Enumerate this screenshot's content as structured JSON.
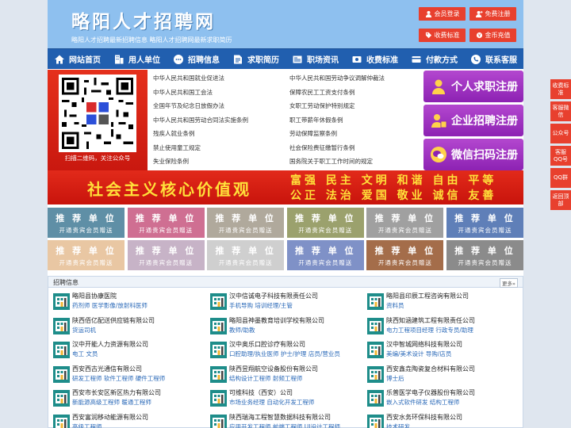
{
  "header": {
    "title": "略阳人才招聘网",
    "subtitle": "略阳人才招聘最新招聘信息  略阳人才招聘网最新求职简历",
    "buttons": [
      {
        "label": "会员登录",
        "icon": "user-icon"
      },
      {
        "label": "免费注册",
        "icon": "user-plus-icon"
      },
      {
        "label": "收费标准",
        "icon": "tag-icon"
      },
      {
        "label": "金币充值",
        "icon": "coin-icon"
      }
    ]
  },
  "nav": [
    {
      "label": "网站首页",
      "icon": "home-icon"
    },
    {
      "label": "用人单位",
      "icon": "building-icon"
    },
    {
      "label": "招聘信息",
      "icon": "chat-icon"
    },
    {
      "label": "求职简历",
      "icon": "resume-icon"
    },
    {
      "label": "职场资讯",
      "icon": "news-icon"
    },
    {
      "label": "收费标准",
      "icon": "money-icon"
    },
    {
      "label": "付款方式",
      "icon": "card-icon"
    },
    {
      "label": "联系客服",
      "icon": "phone-icon"
    }
  ],
  "qr_caption": "扫描二维码，关注公众号",
  "laws": [
    "中华人民共和国就业促进法",
    "中华人民共和国劳动争议调解仲裁法",
    "中华人民共和国工会法",
    "保障农民工工资支付条例",
    "全国年节及纪念日放假办法",
    "女职工劳动保护特别规定",
    "中华人民共和国劳动合同法实施条例",
    "职工带薪年休假条例",
    "残疾人就业条例",
    "劳动保障监察条例",
    "禁止使用童工规定",
    "社会保险费征缴暂行条例",
    "失业保险条例",
    "国务院关于职工工作时间的规定"
  ],
  "register": [
    {
      "label": "个人求职注册",
      "icon": "person-icon"
    },
    {
      "label": "企业招聘注册",
      "icon": "enterprise-icon"
    },
    {
      "label": "微信扫码注册",
      "icon": "wechat-icon"
    }
  ],
  "banner": {
    "left": "社会主义核心价值观",
    "right1": "富强 民主 文明 和谐 自由 平等",
    "right2": "公正 法治 爱国 敬业 诚信 友善"
  },
  "recommended": {
    "title": "推 荐 单 位",
    "sub": "开通贵宾会员赠送",
    "colors": [
      "#5f8fa6",
      "#cf6f92",
      "#b0a99c",
      "#9ba16d",
      "#a0a0a0",
      "#5f7fb8",
      "#e9c7a3",
      "#c7b3c7",
      "#cfcfcf",
      "#7f91c7",
      "#a46d4a",
      "#8b8b8b"
    ]
  },
  "jobs": {
    "title": "招聘信息",
    "more": "更多»",
    "items": [
      {
        "company": "略阳县协康医院",
        "positions": "药剂师 医学影像/放射科医师"
      },
      {
        "company": "汉中信诚电子科技有限责任公司",
        "positions": "手机导购 培训经理/主管"
      },
      {
        "company": "略阳县印辰工程咨询有限公司",
        "positions": "资料员"
      },
      {
        "company": "陕西佰亿配送供应链有限公司",
        "positions": "货运司机"
      },
      {
        "company": "略阳县神墨教育培训学校有限公司",
        "positions": "教师/助教"
      },
      {
        "company": "陕西知涵建筑工程有限责任公司",
        "positions": "电力工程项目经理 行政专员/助理"
      },
      {
        "company": "汉中开能人力资源有限公司",
        "positions": "电工 文员"
      },
      {
        "company": "汉中奥乐口腔诊疗有限公司",
        "positions": "口腔助理/执业医师 护士/护理 店员/营业员"
      },
      {
        "company": "汉中智城网络科技有限公司",
        "positions": "美编/美术设计 导购/店员"
      },
      {
        "company": "西安西古光通信有限公司",
        "positions": "研发工程师 软件工程师 硬件工程师"
      },
      {
        "company": "陕西昱翔航空设备股份有限公司",
        "positions": "结构设计工程师 射频工程师"
      },
      {
        "company": "西安鑫垚陶瓷复合材料有限公司",
        "positions": "博士后"
      },
      {
        "company": "西安市长安区新区热力有限公司",
        "positions": "新能源高级工程师 暖通工程师"
      },
      {
        "company": "可维科技（西安）公司",
        "positions": "市场业务经理 自动化开发工程师"
      },
      {
        "company": "乐普医学电子仪器股份有限公司",
        "positions": "嵌入式软件研发 结构工程师"
      },
      {
        "company": "西安富润移动能源有限公司",
        "positions": "高级工程师"
      },
      {
        "company": "陕西瑞海工程智慧数据科技有限公司",
        "positions": "应用开发工程师 前端工程师 UI设计工程师"
      },
      {
        "company": "西安水务环保科技有限公司",
        "positions": "技术研发"
      }
    ]
  },
  "side": [
    "收费标准",
    "客服微信",
    "公众号",
    "客服QQ号",
    "QQ群",
    "返回顶部"
  ]
}
